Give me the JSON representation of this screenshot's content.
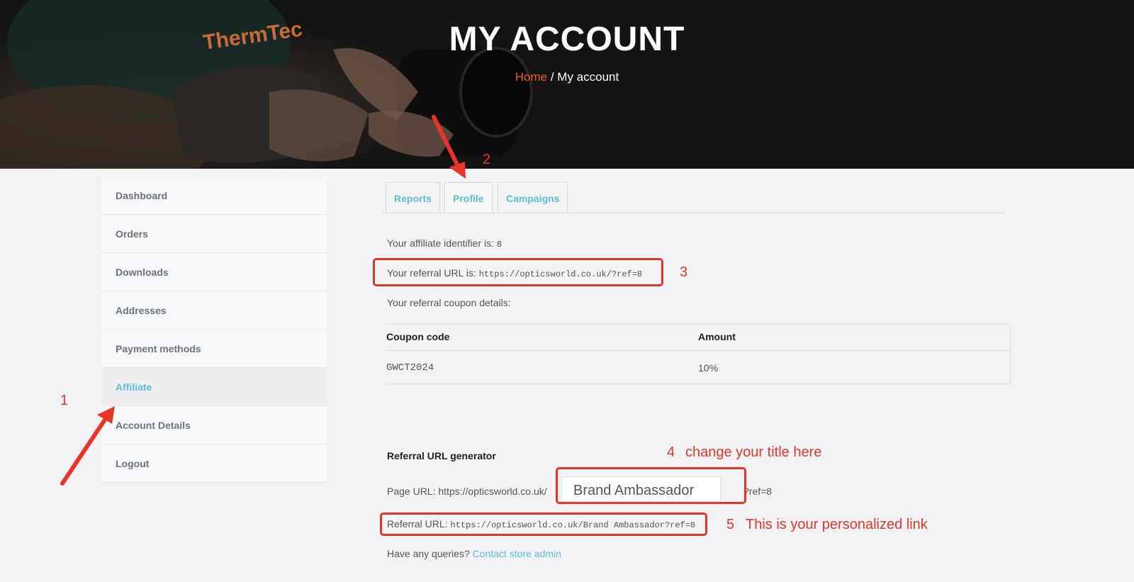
{
  "hero": {
    "title": "MY ACCOUNT",
    "breadcrumb_home": "Home",
    "breadcrumb_separator": " / ",
    "breadcrumb_current": "My account",
    "photo_logo_text": "ThermTec"
  },
  "sidebar": {
    "items": [
      {
        "label": "Dashboard"
      },
      {
        "label": "Orders"
      },
      {
        "label": "Downloads"
      },
      {
        "label": "Addresses"
      },
      {
        "label": "Payment methods"
      },
      {
        "label": "Affiliate",
        "active": true
      },
      {
        "label": "Account Details"
      },
      {
        "label": "Logout"
      }
    ]
  },
  "tabs": [
    {
      "label": "Reports"
    },
    {
      "label": "Profile",
      "active": true
    },
    {
      "label": "Campaigns"
    }
  ],
  "profile": {
    "identifier_label": "Your affiliate identifier is: ",
    "identifier_value": "8",
    "referral_url_label": "Your referral URL is: ",
    "referral_url_value": "https://opticsworld.co.uk/?ref=8",
    "coupon_details_label": "Your referral coupon details:",
    "coupon_table": {
      "headers": [
        "Coupon code",
        "Amount"
      ],
      "rows": [
        [
          "GWCT2024",
          "10%"
        ]
      ]
    }
  },
  "generator": {
    "title": "Referral URL generator",
    "page_url_prefix": "Page URL: https://opticsworld.co.uk/",
    "page_url_input_value": "Brand Ambassador",
    "page_url_suffix": "?ref=8",
    "referral_url_label": "Referral URL: ",
    "referral_url_value": "https://opticsworld.co.uk/Brand Ambassador?ref=8",
    "queries_text": "Have any queries? ",
    "contact_link": "Contact store admin"
  },
  "annotations": {
    "n1": "1",
    "n2": "2",
    "n3": "3",
    "n4": "4",
    "n4_text": "change your title here",
    "n5": "5",
    "n5_text": "This is your personalized link"
  },
  "colors": {
    "accent": "#5bbdd6",
    "breadcrumb_home": "#f05a28",
    "annotation_red": "#e8352a",
    "hero_bg": "#1b1b1b",
    "page_bg": "#f3f3f5"
  }
}
